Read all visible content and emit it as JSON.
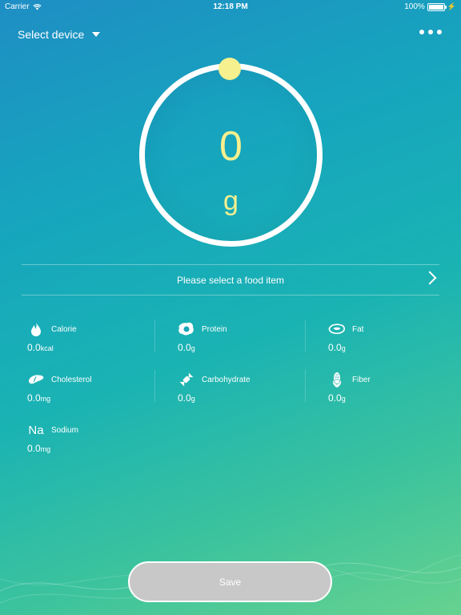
{
  "status_bar": {
    "carrier": "Carrier",
    "time": "12:18 PM",
    "battery": "100%"
  },
  "header": {
    "device_select": "Select device"
  },
  "scale": {
    "value": "0",
    "unit": "g"
  },
  "food": {
    "prompt": "Please select a food item"
  },
  "nutrients": [
    {
      "name": "Calorie",
      "value": "0.0",
      "unit": "kcal",
      "icon": "flame-icon"
    },
    {
      "name": "Protein",
      "value": "0.0",
      "unit": "g",
      "icon": "egg-icon"
    },
    {
      "name": "Fat",
      "value": "0.0",
      "unit": "g",
      "icon": "steak-icon"
    },
    {
      "name": "Cholesterol",
      "value": "0.0",
      "unit": "mg",
      "icon": "liver-icon"
    },
    {
      "name": "Carbohydrate",
      "value": "0.0",
      "unit": "g",
      "icon": "candy-icon"
    },
    {
      "name": "Fiber",
      "value": "0.0",
      "unit": "g",
      "icon": "corn-icon"
    },
    {
      "name": "Sodium",
      "value": "0.0",
      "unit": "mg",
      "icon": "sodium-icon",
      "icon_text": "Na"
    }
  ],
  "actions": {
    "save": "Save"
  },
  "colors": {
    "accent_yellow": "#f6f08f",
    "button_disabled": "#c8c8c8"
  }
}
